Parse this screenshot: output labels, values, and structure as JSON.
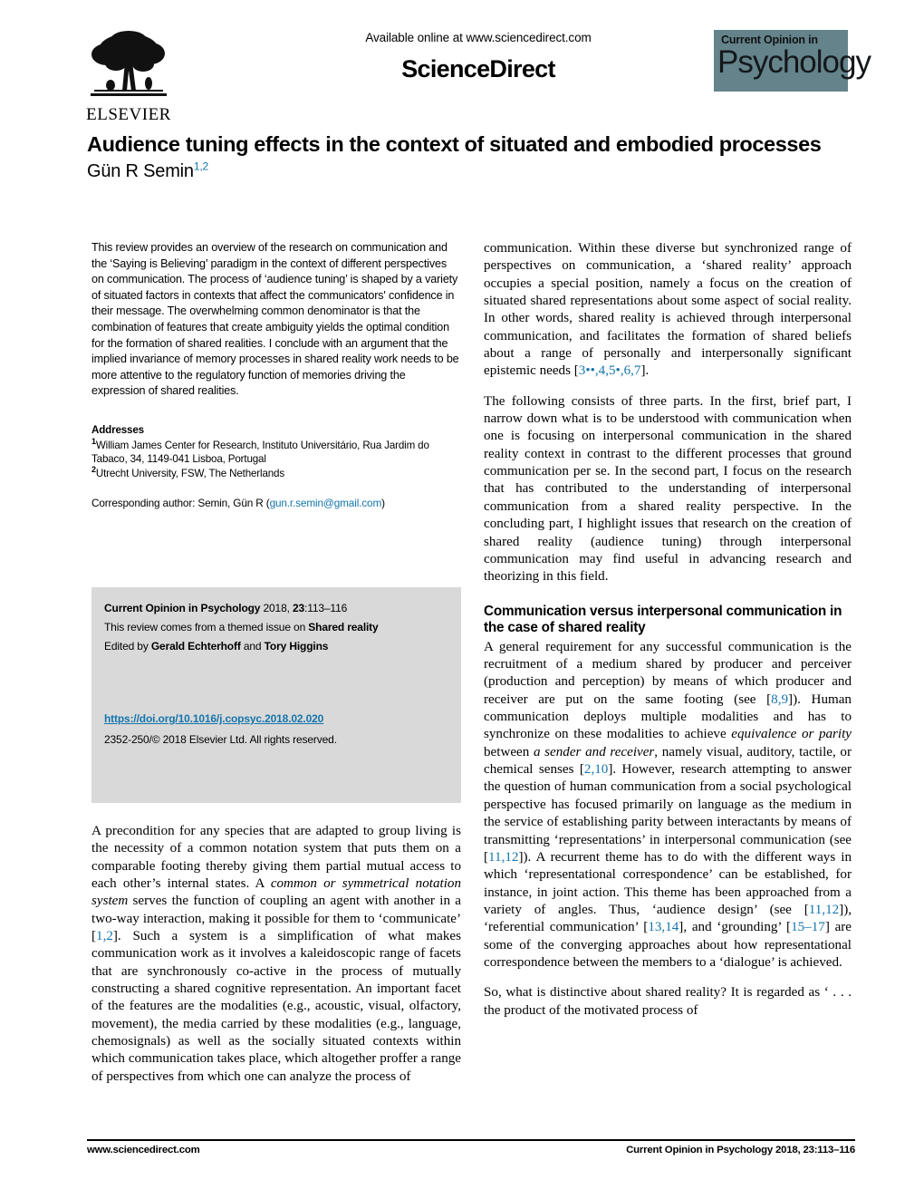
{
  "header": {
    "available_online": "Available online at www.sciencedirect.com",
    "sciencedirect_brand": "ScienceDirect",
    "elsevier_wordmark": "ELSEVIER",
    "journal_badge": {
      "line1": "Current Opinion in",
      "line2": "Psychology",
      "background_color": "#64838b"
    }
  },
  "title": {
    "text": "Audience tuning effects in the context of situated and embodied processes",
    "author": "Gün R Semin",
    "author_affiliation_marks": "1,2"
  },
  "abstract": {
    "text": "This review provides an overview of the research on communication and the ‘Saying is Believing’ paradigm in the context of different perspectives on communication. The process of ‘audience tuning’ is shaped by a variety of situated factors in contexts that affect the communicators' confidence in their message. The overwhelming common denominator is that the combination of features that create ambiguity yields the optimal condition for the formation of shared realities. I conclude with an argument that the implied invariance of memory processes in shared reality work needs to be more attentive to the regulatory function of memories driving the expression of shared realities."
  },
  "addresses": {
    "heading": "Addresses",
    "items": [
      {
        "mark": "1",
        "text": "William James Center for Research, Instituto Universitário, Rua Jardim do Tabaco, 34, 1149-041 Lisboa, Portugal"
      },
      {
        "mark": "2",
        "text": "Utrecht University, FSW, The Netherlands"
      }
    ],
    "corresponding_prefix": "Corresponding author: Semin, Gün R (",
    "corresponding_email": "gun.r.semin@gmail.com",
    "corresponding_suffix": ")"
  },
  "info_box": {
    "journal_name": "Current Opinion in Psychology",
    "journal_year_volume": " 2018, ",
    "volume": "23",
    "pages": ":113–116",
    "themed_issue_prefix": "This review comes from a themed issue on ",
    "themed_issue_name": "Shared reality",
    "edited_by_prefix": "Edited by ",
    "editor_1": "Gerald Echterhoff",
    "edited_by_join": " and ",
    "editor_2": "Tory Higgins",
    "doi": "https://doi.org/10.1016/j.copsyc.2018.02.020",
    "issn_copyright": "2352-250/© 2018 Elsevier Ltd. All rights reserved.",
    "background_color": "#d9d9d9"
  },
  "left_column_body": {
    "paragraph_1_part_1": "A precondition for any species that are adapted to group living is the necessity of a common notation system that puts them on a comparable footing thereby giving them partial mutual access to each other’s internal states. A ",
    "paragraph_1_italic_1": "common or symmetrical notation system",
    "paragraph_1_part_2": " serves the function of coupling an agent with another in a two-way interaction, making it possible for them to ‘communicate’ [",
    "paragraph_1_cite_1": "1,2",
    "paragraph_1_part_3": "]. Such a system is a simplification of what makes communication work as it involves a kaleidoscopic range of facets that are synchronously co-active in the process of mutually constructing a shared cognitive representation. An important facet of the features are the modalities (e.g., acoustic, visual, olfactory, movement), the media carried by these modalities (e.g., language, chemosignals) as well as the socially situated contexts within which communication takes place, which altogether proffer a range of perspectives from which one can analyze the process of"
  },
  "right_column": {
    "paragraph_1_part_1": "communication. Within these diverse but synchronized range of perspectives on communication, a ‘shared reality’ approach occupies a special position, namely a focus on the creation of situated shared representations about some aspect of social reality. In other words, shared reality is achieved through interpersonal communication, and facilitates the formation of shared beliefs about a range of personally and interpersonally significant epistemic needs [",
    "paragraph_1_cite": "3••,4,5•,6,7",
    "paragraph_1_part_2": "].",
    "paragraph_2": "The following consists of three parts. In the first, brief part, I narrow down what is to be understood with communication when one is focusing on interpersonal communication in the shared reality context in contrast to the different processes that ground communication per se. In the second part, I focus on the research that has contributed to the understanding of interpersonal communication from a shared reality perspective. In the concluding part, I highlight issues that research on the creation of shared reality (audience tuning) through interpersonal communication may find useful in advancing research and theorizing in this field.",
    "section_heading": "Communication versus interpersonal communication in the case of shared reality",
    "section_p1_part_1": "A general requirement for any successful communication is the recruitment of a medium shared by producer and perceiver (production and perception) by means of which producer and receiver are put on the same footing (see [",
    "section_p1_cite_1": "8,9",
    "section_p1_part_2": "]). Human communication deploys multiple modalities and has to synchronize on these modalities to achieve ",
    "section_p1_italic_1": "equivalence or parity",
    "section_p1_part_3": " between ",
    "section_p1_italic_2": "a sender and receiver",
    "section_p1_part_4": ", namely visual, auditory, tactile, or chemical senses [",
    "section_p1_cite_2": "2,10",
    "section_p1_part_5": "]. However, research attempting to answer the question of human communication from a social psychological perspective has focused primarily on language as the medium in the service of establishing parity between interactants by means of transmitting ‘representations’ in interpersonal communication (see [",
    "section_p1_cite_3": "11,12",
    "section_p1_part_6": "]). A recurrent theme has to do with the different ways in which ‘representational correspondence’ can be established, for instance, in joint action. This theme has been approached from a variety of angles. Thus, ‘audience design’ (see [",
    "section_p1_cite_4": "11,12",
    "section_p1_part_7": "]), ‘referential communication’ [",
    "section_p1_cite_5": "13,14",
    "section_p1_part_8": "], and ‘grounding’ [",
    "section_p1_cite_6": "15–17",
    "section_p1_part_9": "] are some of the converging approaches about how representational correspondence between the members to a ‘dialogue’ is achieved.",
    "paragraph_last": "So, what is distinctive about shared reality? It is regarded as ‘ . . . the product of the motivated process of"
  },
  "footer": {
    "left": "www.sciencedirect.com",
    "right_journal": "Current Opinion in Psychology",
    "right_citation": " 2018, ",
    "right_volume": "23",
    "right_pages": ":113–116"
  },
  "colors": {
    "link_blue": "#1575ad",
    "badge_teal": "#64838b",
    "info_gray": "#d9d9d9"
  }
}
